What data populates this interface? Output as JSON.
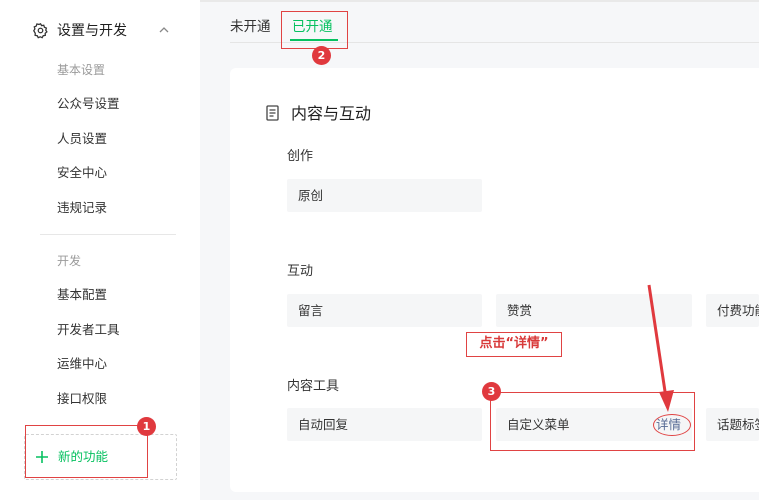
{
  "sidebar": {
    "header": {
      "title": "设置与开发",
      "icon": "gear-icon",
      "chevron": "chevron-up-icon"
    },
    "groups": [
      {
        "label": "基本设置",
        "items": [
          "公众号设置",
          "人员设置",
          "安全中心",
          "违规记录"
        ]
      },
      {
        "label": "开发",
        "items": [
          "基本配置",
          "开发者工具",
          "运维中心",
          "接口权限"
        ]
      }
    ],
    "new_feature": {
      "label": "新的功能",
      "icon": "plus-icon"
    }
  },
  "tabs": [
    {
      "label": "未开通",
      "active": false
    },
    {
      "label": "已开通",
      "active": true
    }
  ],
  "card": {
    "title": "内容与互动",
    "icon": "document-icon",
    "sections": [
      {
        "label": "创作",
        "items": [
          {
            "label": "原创"
          }
        ]
      },
      {
        "label": "互动",
        "items": [
          {
            "label": "留言"
          },
          {
            "label": "赞赏"
          },
          {
            "label": "付费功能"
          }
        ]
      },
      {
        "label": "内容工具",
        "items": [
          {
            "label": "自动回复"
          },
          {
            "label": "自定义菜单",
            "action": "详情"
          },
          {
            "label": "话题标签"
          }
        ]
      }
    ]
  },
  "annotations": {
    "callout_text": "点击“详情”",
    "badges": [
      "1",
      "2",
      "3"
    ],
    "color": "#e0393e"
  },
  "colors": {
    "accent": "#07c160",
    "link": "#576b95",
    "tile_bg": "#f5f6f7",
    "page_bg": "#f6f7f9"
  }
}
